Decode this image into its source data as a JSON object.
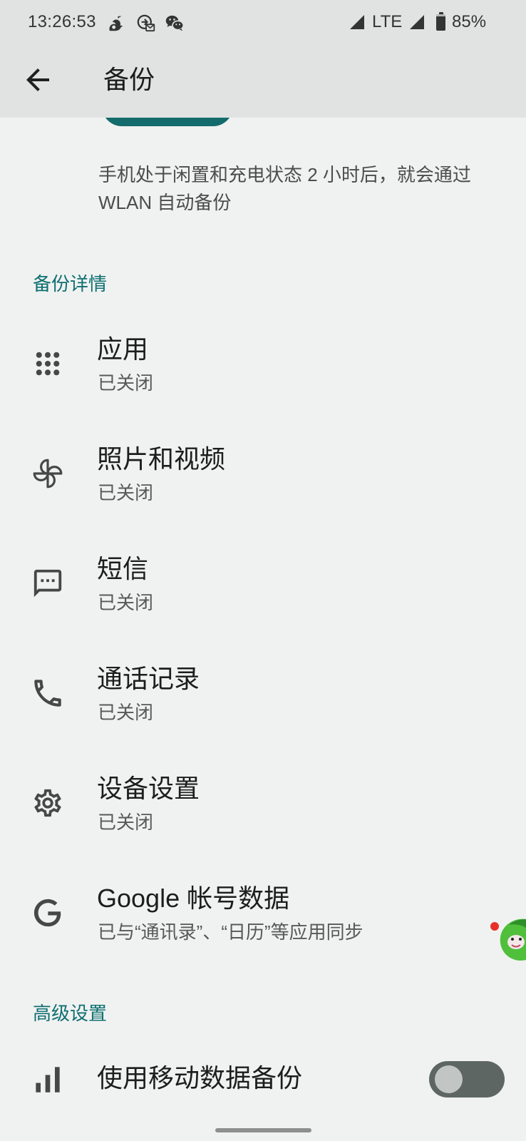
{
  "status_bar": {
    "time": "13:26:53",
    "notification_icons": [
      "squirrel-app-icon",
      "mail-app-icon",
      "wechat-icon"
    ],
    "signal_icon": "cell-signal-icon",
    "network": "LTE",
    "battery": "85%",
    "battery_level": 0.85
  },
  "app_bar": {
    "back_icon": "arrow-back-icon",
    "title": "备份"
  },
  "intro": {
    "description_lines": [
      "手机处于闲置和充电状态 2 小时后，就会通过",
      "WLAN 自动备份"
    ]
  },
  "backup_details": {
    "header": "备份详情",
    "items": [
      {
        "icon": "apps-grid-icon",
        "title": "应用",
        "subtitle": "已关闭"
      },
      {
        "icon": "photos-pinwheel-icon",
        "title": "照片和视频",
        "subtitle": "已关闭"
      },
      {
        "icon": "sms-icon",
        "title": "短信",
        "subtitle": "已关闭"
      },
      {
        "icon": "phone-icon",
        "title": "通话记录",
        "subtitle": "已关闭"
      },
      {
        "icon": "gear-icon",
        "title": "设备设置",
        "subtitle": "已关闭"
      },
      {
        "icon": "google-g-icon",
        "title": "Google 帐号数据",
        "subtitle": "已与“通讯录”、“日历”等应用同步"
      }
    ]
  },
  "advanced_settings": {
    "header": "高级设置",
    "mobile_data_backup": {
      "icon": "bar-chart-icon",
      "label": "使用移动数据备份",
      "enabled": false
    }
  },
  "colors": {
    "accent": "#0f6f71",
    "app_bar_background": "#e1e3e2",
    "page_background": "#f0f2f1",
    "toggle_track_off": "#5e6664",
    "toggle_thumb_off": "#c1c6c4",
    "action_button": "#146b6c"
  }
}
